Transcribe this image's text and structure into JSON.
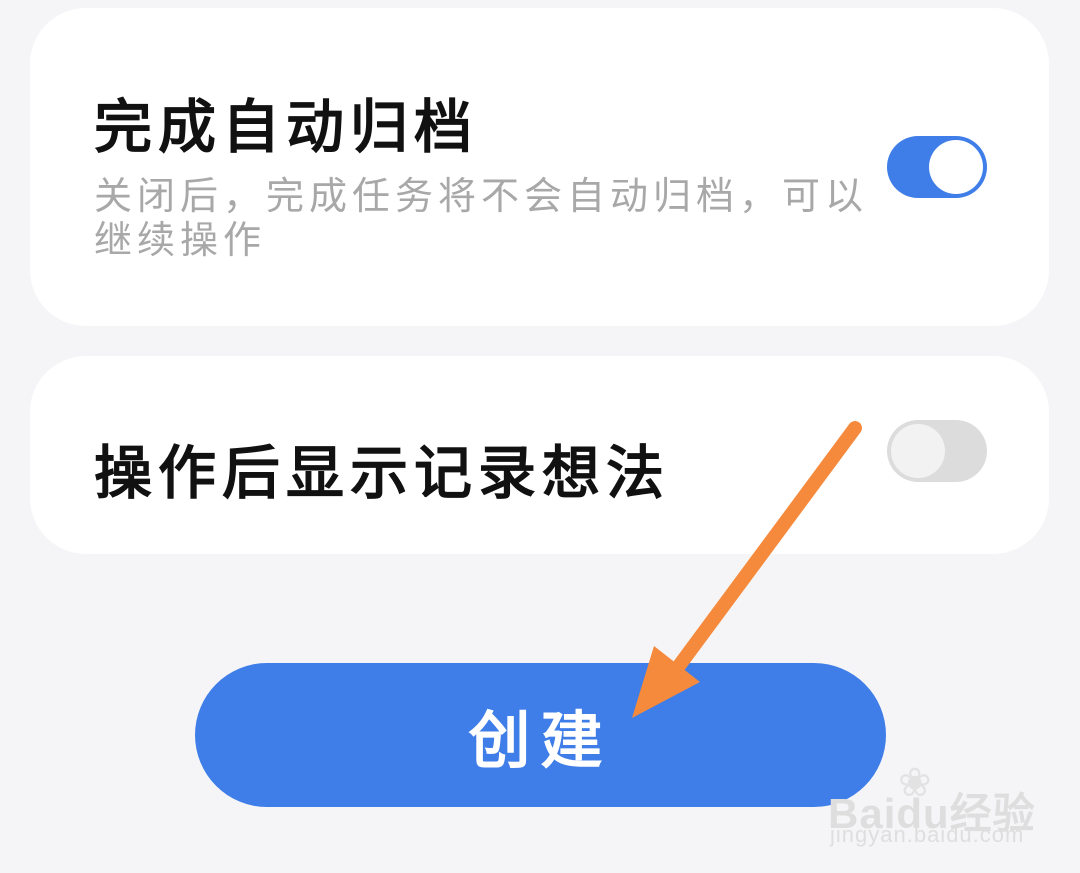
{
  "settings": {
    "auto_archive": {
      "title": "完成自动归档",
      "description": "关闭后，完成任务将不会自动归档，可以继续操作",
      "enabled": true
    },
    "show_thoughts": {
      "title": "操作后显示记录想法",
      "enabled": false
    }
  },
  "create_button": {
    "label": "创建"
  },
  "annotation": {
    "arrow_color": "#f58a3c"
  },
  "colors": {
    "accent": "#3f7ee8",
    "background": "#f5f5f7",
    "card": "#ffffff",
    "toggle_off": "#dcdcdc",
    "description_text": "#a8a8a8"
  },
  "watermark": {
    "logo": "Baidu经验",
    "url": "jingyan.baidu.com"
  }
}
